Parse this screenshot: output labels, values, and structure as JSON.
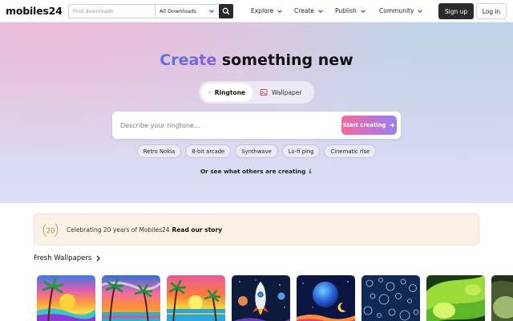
{
  "header": {
    "logo": "mobiles24",
    "search": {
      "placeholder": "Find downloads",
      "value": ""
    },
    "category_select": {
      "selected": "All Downloads"
    },
    "nav": [
      {
        "label": "Explore"
      },
      {
        "label": "Create"
      },
      {
        "label": "Publish"
      },
      {
        "label": "Community"
      }
    ],
    "signup_label": "Sign up",
    "login_label": "Log in"
  },
  "hero": {
    "title_accent": "Create",
    "title_rest": " something new",
    "modes": [
      {
        "label": "Ringtone",
        "icon": "music-note-icon",
        "active": true
      },
      {
        "label": "Wallpaper",
        "icon": "image-icon",
        "active": false
      }
    ],
    "prompt": {
      "placeholder": "Describe your ringtone...",
      "value": ""
    },
    "start_button": "Start creating",
    "suggestions": [
      "Retro Nokia",
      "8-bit arcade",
      "Synthwave",
      "Lo-fi ping",
      "Cinematic rise"
    ],
    "see_others": "Or see what others are creating ↓"
  },
  "banner": {
    "badge": "20",
    "text": "Celebrating 20 years of Mobiles24",
    "link": "Read our story"
  },
  "wallpapers": {
    "title": "Fresh Wallpapers",
    "items": [
      {
        "subject": "palm-sunset-rainbow"
      },
      {
        "subject": "palm-beach-sunset"
      },
      {
        "subject": "palm-island-sunset"
      },
      {
        "subject": "space-rocket-planets"
      },
      {
        "subject": "planet-moon-night"
      },
      {
        "subject": "bubbles-dark-blue"
      },
      {
        "subject": "green-abstract-waves"
      },
      {
        "subject": "green-abstract-partial"
      }
    ]
  },
  "colors": {
    "accent_gradient_start": "#f06aa0",
    "accent_gradient_end": "#9b7ff0",
    "title_accent": "#5a6fe0",
    "dark_button": "#2b2b2f",
    "banner_bg": "#fcf1e7"
  }
}
